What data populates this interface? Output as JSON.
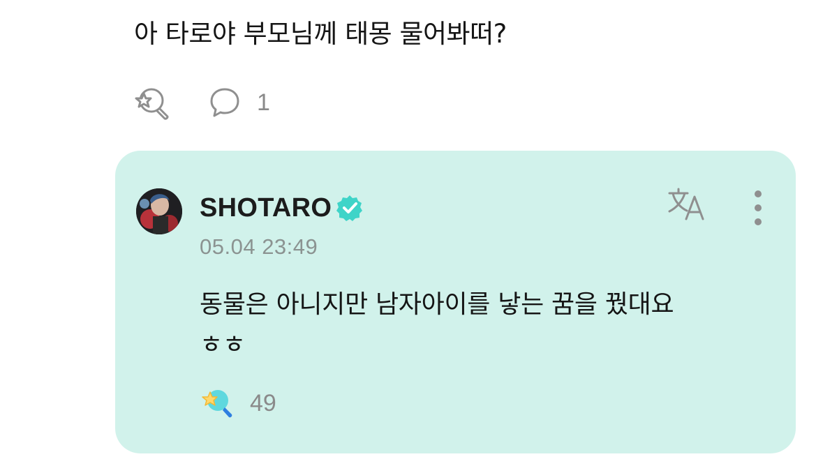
{
  "post": {
    "text": "아 타로야 부모님께 태몽 물어봐떠?",
    "like_icon": "star-lollipop-outline-icon",
    "comment_icon": "speech-bubble-icon",
    "comment_count": "1"
  },
  "reply": {
    "username": "SHOTARO",
    "verified_icon": "verified-badge-icon",
    "timestamp": "05.04 23:49",
    "text_line1": "동물은 아니지만 남자아이를 낳는 꿈을 꿨대요",
    "text_line2": "ㅎㅎ",
    "like_icon": "star-lollipop-filled-icon",
    "like_count": "49",
    "translate_icon": "translate-icon",
    "more_icon": "more-vertical-icon"
  },
  "colors": {
    "card_background": "#d1f2eb",
    "verified_badge": "#3fd4c8",
    "muted_text": "#8a8a8a"
  }
}
